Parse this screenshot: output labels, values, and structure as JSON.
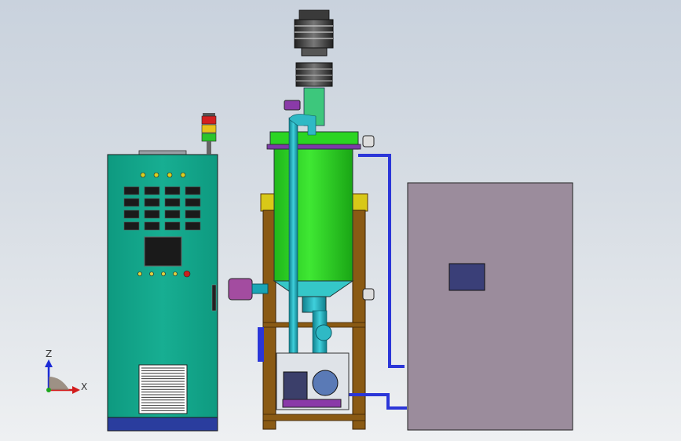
{
  "axes_triad": {
    "z_label": "Z",
    "x_label": "X"
  },
  "colors": {
    "cabinet": "#12a58a",
    "cabinet_base": "#2a3d9e",
    "tank": "#23d11c",
    "frame": "#8a5a14",
    "pipe": "#1aa5b5",
    "blue_pipe": "#2b36d8",
    "unit_box": "#9b8c9c",
    "unit_window": "#3a3f78",
    "motor": "#4a4a4a"
  },
  "control_panel": {
    "indicator_lamps": 4,
    "meter_rows": 4,
    "meter_cols": 4,
    "buttons": 5
  },
  "signal_tower": {
    "lights": [
      "red",
      "yellow",
      "green"
    ]
  }
}
